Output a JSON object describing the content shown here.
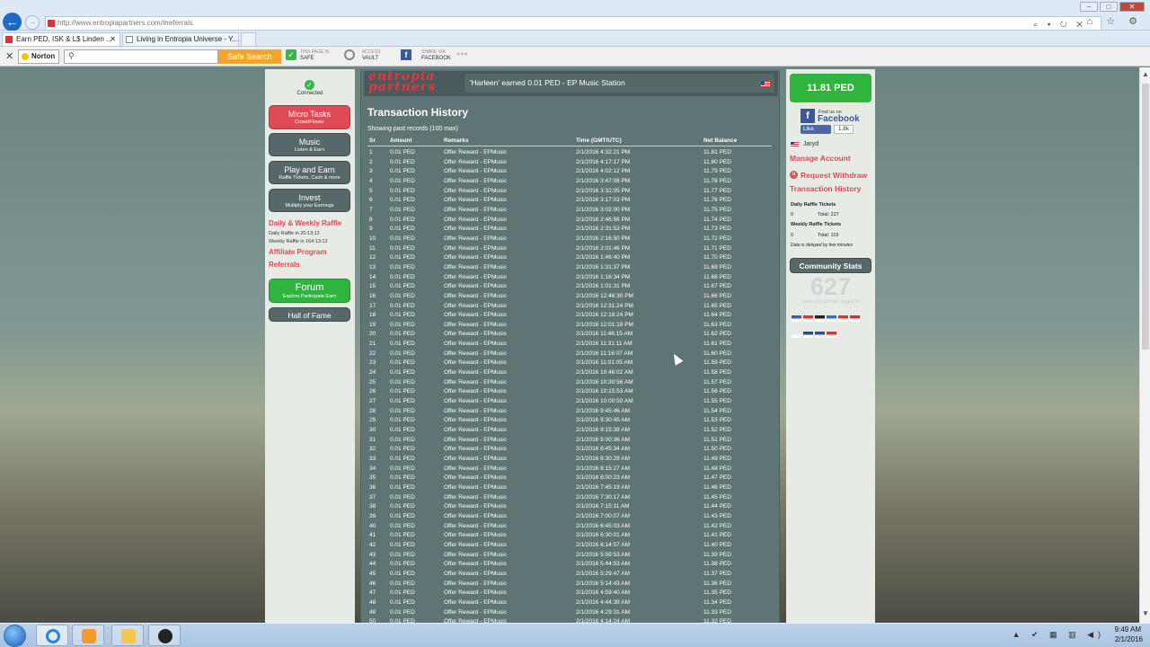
{
  "browser": {
    "url": "http://www.entropiapartners.com/#referrals",
    "window_controls": [
      "–",
      "□",
      "✕"
    ],
    "nav_icons": "⌕ ▾ ↻ ✕",
    "right_icons": "⌂ ☆ ⚙",
    "tabs": [
      {
        "title": "Earn PED, ISK & L$ Linden ...",
        "active": true
      },
      {
        "title": "Living in Entropia Universe - Y...",
        "active": false
      }
    ]
  },
  "norton": {
    "logo": "Norton",
    "search_placeholder": "",
    "safe_search": "Safe Search",
    "safe_top": "THIS PAGE IS",
    "safe_bottom": "SAFE",
    "vault_top": "ACCESS",
    "vault_bottom": "VAULT",
    "share_top": "SHARE VIA",
    "share_bottom": "FACEBOOK",
    "more": "●●●"
  },
  "left": {
    "connected": "Connected",
    "micro_tasks": {
      "title": "Micro Tasks",
      "sub": "CrowdFlower"
    },
    "music": {
      "title": "Music",
      "sub": "Listen & Earn"
    },
    "play": {
      "title": "Play and Earn",
      "sub": "Raffle Tickets, Cash & more"
    },
    "invest": {
      "title": "Invest",
      "sub": "Multiply your Earnings"
    },
    "daily_weekly": "Daily & Weekly Raffle",
    "daily_in": "Daily Raffle in 20:13:12",
    "weekly_in": "Weekly Raffle in 164:13:12",
    "affiliate": "Affiliate Program",
    "referrals": "Referrals",
    "forum": {
      "title": "Forum",
      "sub": "Explore.Participate.Earn"
    },
    "hall_of_fame": "Hall of Fame"
  },
  "center": {
    "logo_line1": "entropia",
    "logo_line2": "partners",
    "banner": "'Harleen' earned 0.01 PED - EP Music Station",
    "title": "Transaction History",
    "subtitle": "Showing past records (100 max)",
    "columns": [
      "Sr",
      "Amount",
      "Remarks",
      "Time (GMT/UTC)",
      "Net Balance"
    ],
    "rows": [
      [
        "1",
        "0.01 PED",
        "Offer Reward - EPMusic",
        "2/1/2016 4:32:21 PM",
        "11.81 PED"
      ],
      [
        "2",
        "0.01 PED",
        "Offer Reward - EPMusic",
        "2/1/2016 4:17:17 PM",
        "11.80 PED"
      ],
      [
        "3",
        "0.01 PED",
        "Offer Reward - EPMusic",
        "2/1/2016 4:02:12 PM",
        "11.79 PED"
      ],
      [
        "4",
        "0.01 PED",
        "Offer Reward - EPMusic",
        "2/1/2016 3:47:08 PM",
        "11.78 PED"
      ],
      [
        "5",
        "0.01 PED",
        "Offer Reward - EPMusic",
        "2/1/2016 3:32:05 PM",
        "11.77 PED"
      ],
      [
        "6",
        "0.01 PED",
        "Offer Reward - EPMusic",
        "2/1/2016 3:17:03 PM",
        "11.76 PED"
      ],
      [
        "7",
        "0.01 PED",
        "Offer Reward - EPMusic",
        "2/1/2016 3:02:00 PM",
        "11.75 PED"
      ],
      [
        "8",
        "0.01 PED",
        "Offer Reward - EPMusic",
        "2/1/2016 2:46:56 PM",
        "11.74 PED"
      ],
      [
        "9",
        "0.01 PED",
        "Offer Reward - EPMusic",
        "2/1/2016 2:31:53 PM",
        "11.73 PED"
      ],
      [
        "10",
        "0.01 PED",
        "Offer Reward - EPMusic",
        "2/1/2016 2:16:50 PM",
        "11.72 PED"
      ],
      [
        "11",
        "0.01 PED",
        "Offer Reward - EPMusic",
        "2/1/2016 2:01:46 PM",
        "11.71 PED"
      ],
      [
        "12",
        "0.01 PED",
        "Offer Reward - EPMusic",
        "2/1/2016 1:46:40 PM",
        "11.70 PED"
      ],
      [
        "13",
        "0.01 PED",
        "Offer Reward - EPMusic",
        "2/1/2016 1:31:37 PM",
        "11.69 PED"
      ],
      [
        "14",
        "0.01 PED",
        "Offer Reward - EPMusic",
        "2/1/2016 1:16:34 PM",
        "11.68 PED"
      ],
      [
        "15",
        "0.01 PED",
        "Offer Reward - EPMusic",
        "2/1/2016 1:01:31 PM",
        "11.67 PED"
      ],
      [
        "16",
        "0.01 PED",
        "Offer Reward - EPMusic",
        "2/1/2016 12:46:30 PM",
        "11.66 PED"
      ],
      [
        "17",
        "0.01 PED",
        "Offer Reward - EPMusic",
        "2/1/2016 12:31:24 PM",
        "11.65 PED"
      ],
      [
        "18",
        "0.01 PED",
        "Offer Reward - EPMusic",
        "2/1/2016 12:16:24 PM",
        "11.64 PED"
      ],
      [
        "19",
        "0.01 PED",
        "Offer Reward - EPMusic",
        "2/1/2016 12:01:19 PM",
        "11.63 PED"
      ],
      [
        "20",
        "0.01 PED",
        "Offer Reward - EPMusic",
        "2/1/2016 11:46:15 AM",
        "11.62 PED"
      ],
      [
        "21",
        "0.01 PED",
        "Offer Reward - EPMusic",
        "2/1/2016 11:31:11 AM",
        "11.61 PED"
      ],
      [
        "22",
        "0.01 PED",
        "Offer Reward - EPMusic",
        "2/1/2016 11:16:07 AM",
        "11.60 PED"
      ],
      [
        "23",
        "0.01 PED",
        "Offer Reward - EPMusic",
        "2/1/2016 11:01:05 AM",
        "11.59 PED"
      ],
      [
        "24",
        "0.01 PED",
        "Offer Reward - EPMusic",
        "2/1/2016 10:46:02 AM",
        "11.58 PED"
      ],
      [
        "25",
        "0.01 PED",
        "Offer Reward - EPMusic",
        "2/1/2016 10:30:56 AM",
        "11.57 PED"
      ],
      [
        "26",
        "0.01 PED",
        "Offer Reward - EPMusic",
        "2/1/2016 10:15:53 AM",
        "11.56 PED"
      ],
      [
        "27",
        "0.01 PED",
        "Offer Reward - EPMusic",
        "2/1/2016 10:00:50 AM",
        "11.55 PED"
      ],
      [
        "28",
        "0.01 PED",
        "Offer Reward - EPMusic",
        "2/1/2016 9:45:46 AM",
        "11.54 PED"
      ],
      [
        "29",
        "0.01 PED",
        "Offer Reward - EPMusic",
        "2/1/2016 9:30:45 AM",
        "11.53 PED"
      ],
      [
        "30",
        "0.01 PED",
        "Offer Reward - EPMusic",
        "2/1/2016 9:15:39 AM",
        "11.52 PED"
      ],
      [
        "31",
        "0.01 PED",
        "Offer Reward - EPMusic",
        "2/1/2016 9:00:36 AM",
        "11.51 PED"
      ],
      [
        "32",
        "0.01 PED",
        "Offer Reward - EPMusic",
        "2/1/2016 8:45:34 AM",
        "11.50 PED"
      ],
      [
        "33",
        "0.01 PED",
        "Offer Reward - EPMusic",
        "2/1/2016 8:30:29 AM",
        "11.49 PED"
      ],
      [
        "34",
        "0.01 PED",
        "Offer Reward - EPMusic",
        "2/1/2016 8:15:27 AM",
        "11.48 PED"
      ],
      [
        "35",
        "0.01 PED",
        "Offer Reward - EPMusic",
        "2/1/2016 8:00:23 AM",
        "11.47 PED"
      ],
      [
        "36",
        "0.01 PED",
        "Offer Reward - EPMusic",
        "2/1/2016 7:45:19 AM",
        "11.46 PED"
      ],
      [
        "37",
        "0.01 PED",
        "Offer Reward - EPMusic",
        "2/1/2016 7:30:17 AM",
        "11.45 PED"
      ],
      [
        "38",
        "0.01 PED",
        "Offer Reward - EPMusic",
        "2/1/2016 7:15:11 AM",
        "11.44 PED"
      ],
      [
        "39",
        "0.01 PED",
        "Offer Reward - EPMusic",
        "2/1/2016 7:00:07 AM",
        "11.43 PED"
      ],
      [
        "40",
        "0.01 PED",
        "Offer Reward - EPMusic",
        "2/1/2016 6:45:03 AM",
        "11.42 PED"
      ],
      [
        "41",
        "0.01 PED",
        "Offer Reward - EPMusic",
        "2/1/2016 6:30:01 AM",
        "11.41 PED"
      ],
      [
        "42",
        "0.01 PED",
        "Offer Reward - EPMusic",
        "2/1/2016 6:14:57 AM",
        "11.40 PED"
      ],
      [
        "43",
        "0.01 PED",
        "Offer Reward - EPMusic",
        "2/1/2016 5:59:53 AM",
        "11.39 PED"
      ],
      [
        "44",
        "0.01 PED",
        "Offer Reward - EPMusic",
        "2/1/2016 5:44:53 AM",
        "11.38 PED"
      ],
      [
        "45",
        "0.01 PED",
        "Offer Reward - EPMusic",
        "2/1/2016 5:29:47 AM",
        "11.37 PED"
      ],
      [
        "46",
        "0.01 PED",
        "Offer Reward - EPMusic",
        "2/1/2016 5:14:43 AM",
        "11.36 PED"
      ],
      [
        "47",
        "0.01 PED",
        "Offer Reward - EPMusic",
        "2/1/2016 4:59:40 AM",
        "11.35 PED"
      ],
      [
        "48",
        "0.01 PED",
        "Offer Reward - EPMusic",
        "2/1/2016 4:44:39 AM",
        "11.34 PED"
      ],
      [
        "49",
        "0.01 PED",
        "Offer Reward - EPMusic",
        "2/1/2016 4:29:31 AM",
        "11.33 PED"
      ],
      [
        "50",
        "0.01 PED",
        "Offer Reward - EPMusic",
        "2/1/2016 4:14:24 AM",
        "11.32 PED"
      ]
    ]
  },
  "right": {
    "balance": "11.81 PED",
    "fb_find": "Find us on",
    "fb_name": "Facebook",
    "fb_like": "Like",
    "fb_count": "1.8k",
    "user": "Jaryd",
    "manage": "Manage Account",
    "withdraw": "Request Withdraw",
    "history": "Transaction History",
    "daily_tickets": "Daily Raffle Tickets",
    "daily_count": "0",
    "daily_total": "Total: 227",
    "weekly_tickets": "Weekly Raffle Tickets",
    "weekly_count": "0",
    "weekly_total": "Total: 119",
    "delay_note": "Data is delayed by few minutes",
    "community": "Community Stats",
    "users_online": "627",
    "users_label": "users are currently logged in",
    "flag_colors": [
      "#3b5bad",
      "#d33",
      "#222",
      "#2e6fd1",
      "#d33",
      "#c33",
      "#e6e6ff",
      "#2b4a8b",
      "#1e4fb3",
      "#e03030"
    ]
  },
  "taskbar": {
    "time": "9:49 AM",
    "date": "2/1/2016",
    "tray": "▲ ✔ ▦ ▥ ◀)"
  }
}
